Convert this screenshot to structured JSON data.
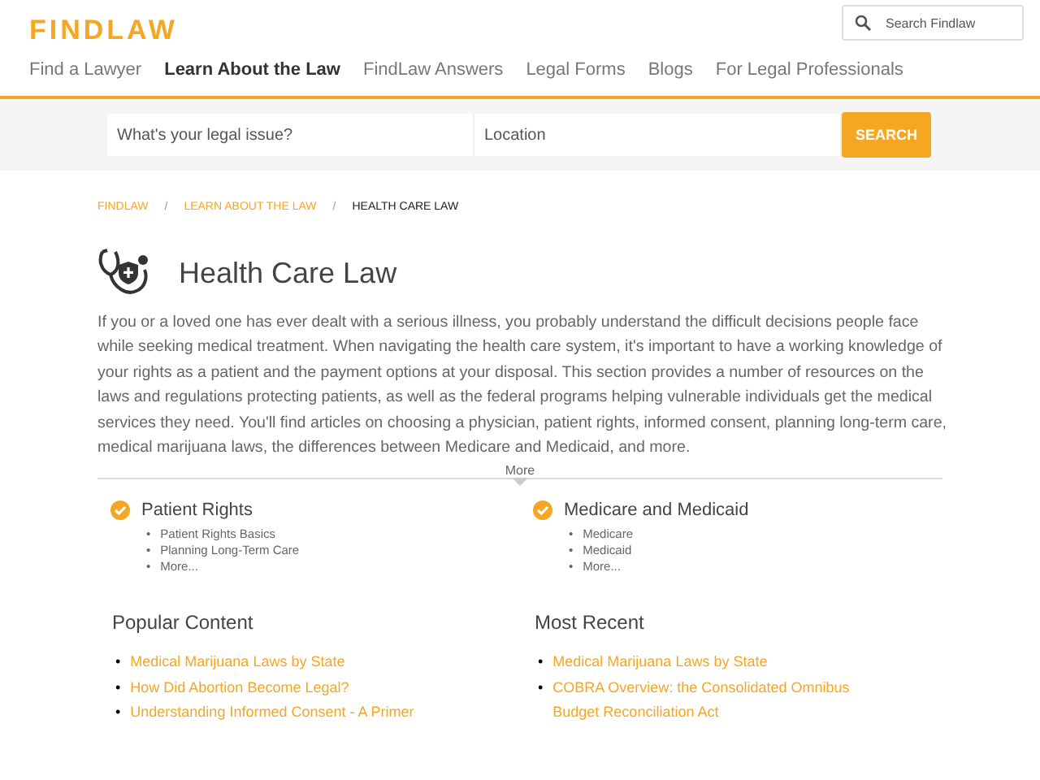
{
  "header": {
    "logo": "FINDLAW",
    "search": {
      "placeholder": "Search Findlaw"
    }
  },
  "nav": [
    {
      "label": "Find a Lawyer",
      "selected": false
    },
    {
      "label": "Learn About the Law",
      "selected": true
    },
    {
      "label": "FindLaw Answers",
      "selected": false
    },
    {
      "label": "Legal Forms",
      "selected": false
    },
    {
      "label": "Blogs",
      "selected": false
    },
    {
      "label": "For Legal Professionals",
      "selected": false
    }
  ],
  "search_bar": {
    "issue_placeholder": "What's your legal issue?",
    "location_placeholder": "Location",
    "button": "SEARCH"
  },
  "breadcrumb": [
    {
      "label": "FINDLAW",
      "current": false
    },
    {
      "label": "LEARN ABOUT THE LAW",
      "current": false
    },
    {
      "label": "HEALTH CARE LAW",
      "current": true
    }
  ],
  "breadcrumb_separator": "/",
  "title": "Health Care Law",
  "intro": "If you or a loved one has ever dealt with a serious illness, you probably understand the difficult decisions people face while seeking medical treatment. When navigating the health care system, it's important to have a working knowledge of your rights as a patient and the payment options at your disposal. This section provides a number of resources on the laws and regulations protecting patients, as well as the federal programs helping vulnerable individuals get the medical services they need. You'll find articles on choosing a physician, patient rights, informed consent, planning long-term care, medical marijuana laws, the differences between Medicare and Medicaid, and more.",
  "more": "More",
  "bullet": "•",
  "topics": [
    {
      "title": "Patient Rights",
      "links": [
        "Patient Rights Basics",
        "Planning Long-Term Care",
        "More..."
      ]
    },
    {
      "title": "Medicare and Medicaid",
      "links": [
        "Medicare",
        "Medicaid",
        "More..."
      ]
    }
  ],
  "lists": [
    {
      "title": "Popular Content",
      "links": [
        "Medical Marijuana Laws by State",
        "How Did Abortion Become Legal?",
        "Understanding Informed Consent - A Primer"
      ]
    },
    {
      "title": "Most Recent",
      "links": [
        "Medical Marijuana Laws by State",
        "COBRA Overview: the Consolidated Omnibus Budget Reconciliation Act"
      ]
    }
  ]
}
